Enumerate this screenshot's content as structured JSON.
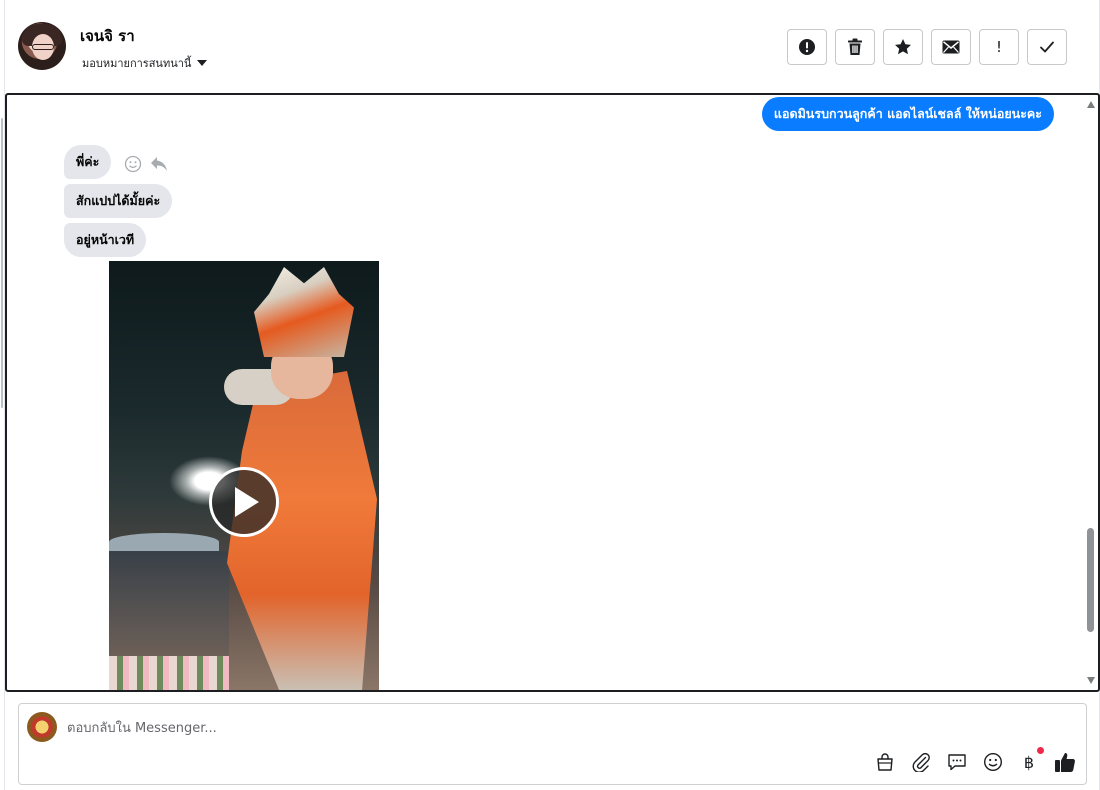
{
  "contact": {
    "name": "เจนจิ รา",
    "assign_label": "มอบหมายการสนทนานี้"
  },
  "toolbar": {
    "buttons": [
      {
        "name": "spam",
        "icon": "alert-circle-icon"
      },
      {
        "name": "delete",
        "icon": "trash-icon"
      },
      {
        "name": "star",
        "icon": "star-icon"
      },
      {
        "name": "mark-unread",
        "icon": "envelope-icon"
      },
      {
        "name": "follow-up",
        "icon": "exclamation-icon",
        "glyph": "!"
      },
      {
        "name": "done",
        "icon": "checkmark-icon"
      }
    ]
  },
  "conversation": {
    "outgoing": [
      {
        "text": "แอดมินรบกวนลูกค้า แอดไลน์เชลล์ ให้หน่อยนะคะ"
      }
    ],
    "incoming": [
      {
        "text": "พี่ค่ะ"
      },
      {
        "text": "สักแปปได้มั้ยค่ะ"
      },
      {
        "text": "อยู่หน้าเวที"
      }
    ],
    "attachment": {
      "type": "video",
      "icon": "play-icon"
    }
  },
  "composer": {
    "placeholder": "ตอบกลับใน Messenger...",
    "tools": [
      "shop-bag-icon",
      "paperclip-icon",
      "saved-replies-icon",
      "emoji-icon",
      "baht-icon",
      "thumbs-up-icon"
    ],
    "baht_symbol": "฿",
    "notification_color": "#f02849"
  },
  "colors": {
    "accent": "#0a7cff",
    "incoming_bubble": "#e4e6eb"
  }
}
